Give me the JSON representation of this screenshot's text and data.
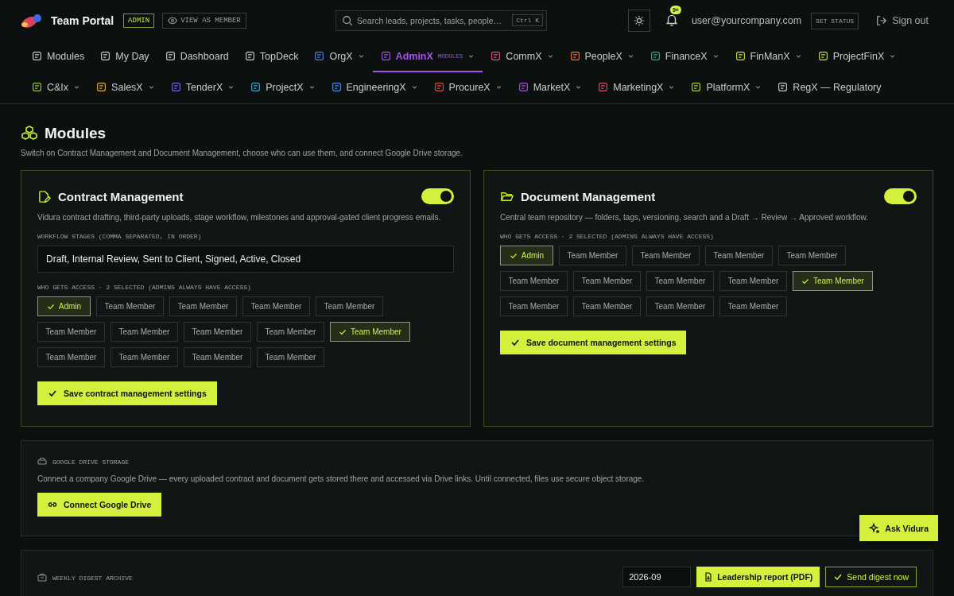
{
  "header": {
    "app_name": "Team Portal",
    "role_badge": "ADMIN",
    "view_as_button": "VIEW AS MEMBER",
    "search": {
      "placeholder": "Search leads, projects, tasks, people…",
      "shortcut": "Ctrl K"
    },
    "notification_count": "9+",
    "user_email": "user@yourcompany.com",
    "status_button": "SET STATUS",
    "sign_out": "Sign out"
  },
  "nav_rows": [
    [
      {
        "label": "Modules",
        "color": "#c8ccc8",
        "dropdown": false,
        "selected": false
      },
      {
        "label": "My Day",
        "color": "#c8ccc8",
        "dropdown": false,
        "selected": false
      },
      {
        "label": "Dashboard",
        "color": "#c8ccc8",
        "dropdown": false,
        "selected": false
      },
      {
        "label": "TopDeck",
        "color": "#c8ccc8",
        "dropdown": false,
        "selected": false
      },
      {
        "label": "OrgX",
        "color": "#4a7fe0",
        "dropdown": true,
        "selected": false
      },
      {
        "label": "AdminX",
        "tag": "MODULES",
        "color": "#a455e8",
        "dropdown": true,
        "selected": true
      },
      {
        "label": "CommX",
        "color": "#e0508a",
        "dropdown": true,
        "selected": false
      },
      {
        "label": "PeopleX",
        "color": "#e8773a",
        "dropdown": true,
        "selected": false
      },
      {
        "label": "FinanceX",
        "color": "#2fae7a",
        "dropdown": true,
        "selected": false
      },
      {
        "label": "FinManX",
        "color": "#c9d93a",
        "dropdown": true,
        "selected": false
      },
      {
        "label": "ProjectFinX",
        "color": "#c9d93a",
        "dropdown": true,
        "selected": false
      }
    ],
    [
      {
        "label": "C&Ix",
        "color": "#8fcf3a",
        "dropdown": true,
        "selected": false
      },
      {
        "label": "SalesX",
        "color": "#e0b030",
        "dropdown": true,
        "selected": false
      },
      {
        "label": "TenderX",
        "color": "#6a6ae8",
        "dropdown": true,
        "selected": false
      },
      {
        "label": "ProjectX",
        "color": "#3aa8d8",
        "dropdown": true,
        "selected": false
      },
      {
        "label": "EngineeringX",
        "color": "#4a90e8",
        "dropdown": true,
        "selected": false
      },
      {
        "label": "ProcureX",
        "color": "#e84a3a",
        "dropdown": true,
        "selected": false
      },
      {
        "label": "MarketX",
        "color": "#b04ae0",
        "dropdown": true,
        "selected": false
      },
      {
        "label": "MarketingX",
        "color": "#e04a6a",
        "dropdown": true,
        "selected": false
      },
      {
        "label": "PlatformX",
        "color": "#a8d83a",
        "dropdown": true,
        "selected": false
      },
      {
        "label": "RegX — Regulatory",
        "color": "#c8ccc8",
        "dropdown": false,
        "selected": false
      }
    ]
  ],
  "page": {
    "title": "Modules",
    "subtitle": "Switch on Contract Management and Document Management, choose who can use them, and connect Google Drive storage."
  },
  "modules": [
    {
      "title": "Contract Management",
      "enabled": true,
      "description": "Vidura contract drafting, third-party uploads, stage workflow, milestones and approval-gated client progress emails.",
      "stages_label": "WORKFLOW STAGES (COMMA SEPARATED, IN ORDER)",
      "stages_value": "Draft, Internal Review, Sent to Client, Signed, Active, Closed",
      "access_label": "WHO GETS ACCESS · 2 SELECTED (ADMINS ALWAYS HAVE ACCESS)",
      "access": [
        {
          "label": "Admin",
          "selected": true
        },
        {
          "label": "Team Member",
          "selected": false
        },
        {
          "label": "Team Member",
          "selected": false
        },
        {
          "label": "Team Member",
          "selected": false
        },
        {
          "label": "Team Member",
          "selected": false
        },
        {
          "label": "Team Member",
          "selected": false
        },
        {
          "label": "Team Member",
          "selected": false
        },
        {
          "label": "Team Member",
          "selected": false
        },
        {
          "label": "Team Member",
          "selected": false
        },
        {
          "label": "Team Member",
          "selected": true
        },
        {
          "label": "Team Member",
          "selected": false
        },
        {
          "label": "Team Member",
          "selected": false
        },
        {
          "label": "Team Member",
          "selected": false
        },
        {
          "label": "Team Member",
          "selected": false
        }
      ],
      "save_button": "Save contract management settings"
    },
    {
      "title": "Document Management",
      "enabled": true,
      "description": "Central team repository — folders, tags, versioning, search and a Draft → Review → Approved workflow.",
      "access_label": "WHO GETS ACCESS · 2 SELECTED (ADMINS ALWAYS HAVE ACCESS)",
      "access": [
        {
          "label": "Admin",
          "selected": true
        },
        {
          "label": "Team Member",
          "selected": false
        },
        {
          "label": "Team Member",
          "selected": false
        },
        {
          "label": "Team Member",
          "selected": false
        },
        {
          "label": "Team Member",
          "selected": false
        },
        {
          "label": "Team Member",
          "selected": false
        },
        {
          "label": "Team Member",
          "selected": false
        },
        {
          "label": "Team Member",
          "selected": false
        },
        {
          "label": "Team Member",
          "selected": false
        },
        {
          "label": "Team Member",
          "selected": true
        },
        {
          "label": "Team Member",
          "selected": false
        },
        {
          "label": "Team Member",
          "selected": false
        },
        {
          "label": "Team Member",
          "selected": false
        },
        {
          "label": "Team Member",
          "selected": false
        }
      ],
      "save_button": "Save document management settings"
    }
  ],
  "drive": {
    "label": "GOOGLE DRIVE STORAGE",
    "description": "Connect a company Google Drive — every uploaded contract and document gets stored there and accessed via Drive links. Until connected, files use secure object storage.",
    "button": "Connect Google Drive"
  },
  "digest": {
    "label": "WEEKLY DIGEST ARCHIVE",
    "month": "2026-09",
    "report_button": "Leadership report (PDF)",
    "send_button": "Send digest now"
  },
  "assistant_button": "Ask Vidura"
}
